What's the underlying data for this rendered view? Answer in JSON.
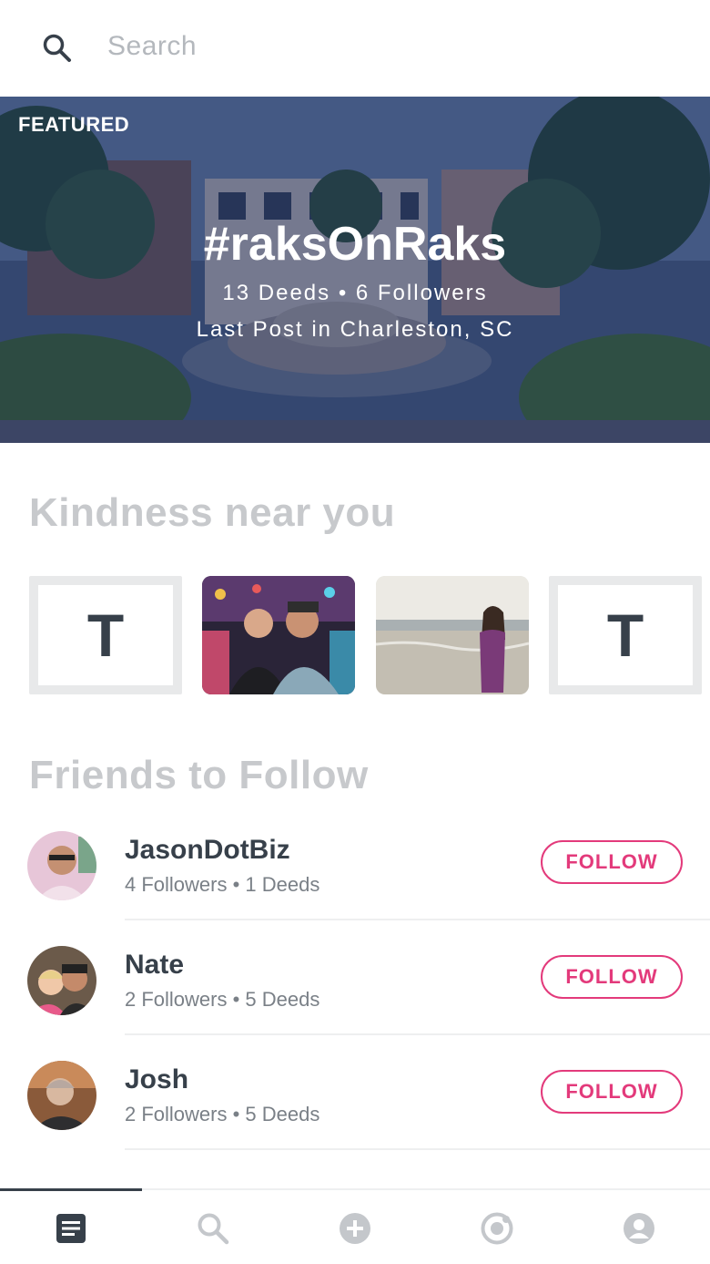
{
  "search": {
    "placeholder": "Search"
  },
  "featured": {
    "label": "FEATURED",
    "title": "#raksOnRaks",
    "stats": "13 Deeds • 6 Followers",
    "location": "Last Post in Charleston, SC"
  },
  "kindness": {
    "title": "Kindness near you",
    "tiles": [
      {
        "type": "letter",
        "letter": "T"
      },
      {
        "type": "photo",
        "icon": "photo-two-men"
      },
      {
        "type": "photo",
        "icon": "photo-woman-beach"
      },
      {
        "type": "letter",
        "letter": "T"
      }
    ]
  },
  "friends": {
    "title": "Friends to Follow",
    "items": [
      {
        "name": "JasonDotBiz",
        "stats": "4 Followers • 1 Deeds",
        "follow_label": "FOLLOW"
      },
      {
        "name": "Nate",
        "stats": "2 Followers • 5 Deeds",
        "follow_label": "FOLLOW"
      },
      {
        "name": "Josh",
        "stats": "2 Followers • 5 Deeds",
        "follow_label": "FOLLOW"
      }
    ]
  },
  "nav": {
    "items": [
      {
        "icon": "feed-icon",
        "active": true
      },
      {
        "icon": "search-icon",
        "active": false
      },
      {
        "icon": "add-icon",
        "active": false
      },
      {
        "icon": "camera-icon",
        "active": false
      },
      {
        "icon": "profile-icon",
        "active": false
      }
    ]
  },
  "colors": {
    "accent": "#e33a7b",
    "text": "#37404a",
    "section_title": "#c7c9cc",
    "hero_overlay": "#162256"
  }
}
